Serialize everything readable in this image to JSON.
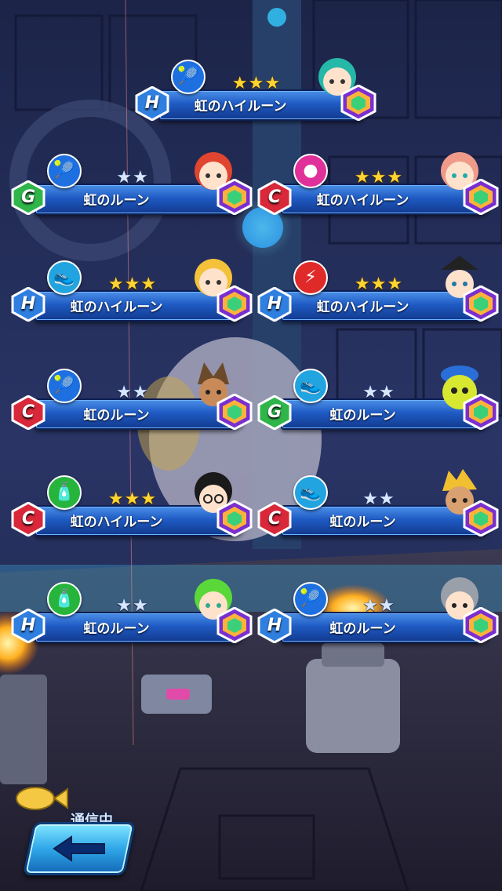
{
  "rewards": [
    {
      "rank": "H",
      "skill": "racket-icon",
      "skill_color": "#1e6fe0",
      "stars": 3,
      "name": "虹のハイルーン"
    },
    {
      "rank": "G",
      "skill": "racket-icon",
      "skill_color": "#1e6fe0",
      "stars": 2,
      "name": "虹のルーン"
    },
    {
      "rank": "C",
      "skill": "ball-icon",
      "skill_color": "#e0309a",
      "stars": 3,
      "name": "虹のハイルーン"
    },
    {
      "rank": "H",
      "skill": "shoe-icon",
      "skill_color": "#22a4e0",
      "stars": 3,
      "name": "虹のハイルーン"
    },
    {
      "rank": "H",
      "skill": "smash-icon",
      "skill_color": "#e02a2a",
      "stars": 3,
      "name": "虹のハイルーン"
    },
    {
      "rank": "C",
      "skill": "racket-icon",
      "skill_color": "#1e6fe0",
      "stars": 2,
      "name": "虹のルーン"
    },
    {
      "rank": "G",
      "skill": "shoe-icon",
      "skill_color": "#22a4e0",
      "stars": 2,
      "name": "虹のルーン"
    },
    {
      "rank": "C",
      "skill": "bottle-icon",
      "skill_color": "#27b43c",
      "stars": 3,
      "name": "虹のハイルーン"
    },
    {
      "rank": "C",
      "skill": "shoe-icon",
      "skill_color": "#22a4e0",
      "stars": 2,
      "name": "虹のルーン"
    },
    {
      "rank": "H",
      "skill": "bottle-icon",
      "skill_color": "#27b43c",
      "stars": 2,
      "name": "虹のルーン"
    },
    {
      "rank": "H",
      "skill": "racket-icon",
      "skill_color": "#1e6fe0",
      "stars": 2,
      "name": "虹のルーン"
    }
  ],
  "rank_colors": {
    "H": "#2f7fe0",
    "G": "#2fb54a",
    "C": "#d8283a"
  },
  "status": {
    "text": "通信中..."
  }
}
